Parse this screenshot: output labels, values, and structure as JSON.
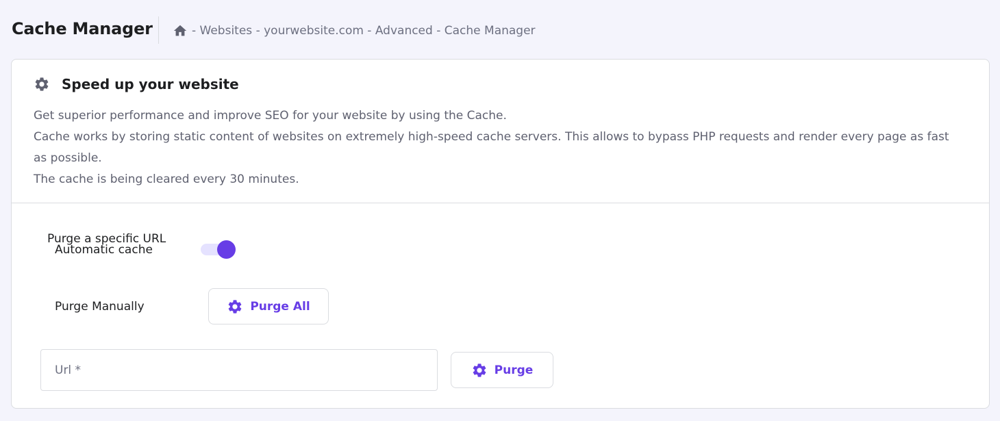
{
  "header": {
    "title": "Cache Manager",
    "breadcrumb": {
      "home_icon": "home-icon",
      "path": "- Websites - yourwebsite.com - Advanced - Cache Manager"
    }
  },
  "card": {
    "icon": "gear-icon",
    "title": "Speed up your website",
    "description": [
      "Get superior performance and improve SEO for your website by using the Cache.",
      "Cache works by storing static content of websites on extremely high-speed cache servers. This allows to bypass PHP requests and render every page as fast as possible.",
      "The cache is being cleared every 30 minutes."
    ]
  },
  "settings": {
    "purge_specific_label": "Purge a specific URL",
    "automatic_cache_label": "Automatic cache",
    "automatic_cache_enabled": true,
    "purge_manually_label": "Purge Manually",
    "purge_all_label": "Purge All",
    "url_placeholder": "Url *",
    "purge_label": "Purge"
  },
  "colors": {
    "accent": "#673de6",
    "toggle_track": "#e5e2ff",
    "background": "#f4f4fc",
    "icon_gray": "#5f6170"
  }
}
